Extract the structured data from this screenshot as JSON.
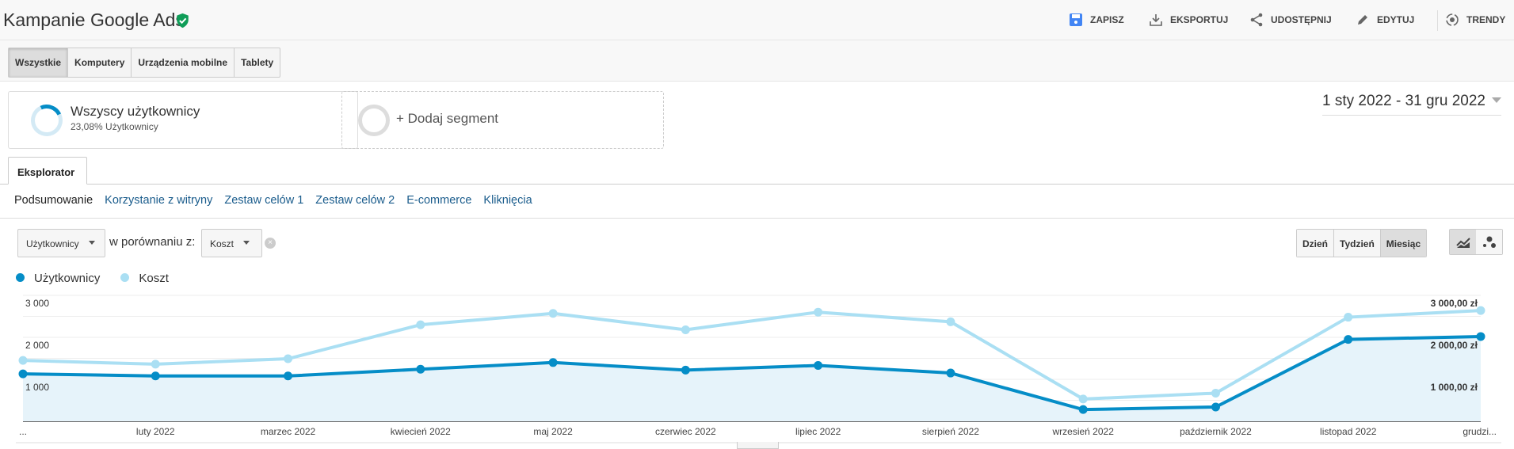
{
  "header": {
    "title": "Kampanie Google Ads",
    "actions": [
      {
        "label": "ZAPISZ",
        "icon": "save-icon"
      },
      {
        "label": "EKSPORTUJ",
        "icon": "download-icon"
      },
      {
        "label": "UDOSTĘPNIJ",
        "icon": "share-icon"
      },
      {
        "label": "EDYTUJ",
        "icon": "pencil-icon"
      },
      {
        "label": "TRENDY",
        "icon": "trends-icon"
      }
    ]
  },
  "device_tabs": [
    "Wszystkie",
    "Komputery",
    "Urządzenia mobilne",
    "Tablety"
  ],
  "segments": {
    "active": {
      "name": "Wszyscy użytkownicy",
      "detail": "23,08% Użytkownicy"
    },
    "add": "+ Dodaj segment"
  },
  "date_range": "1 sty 2022 - 31 gru 2022",
  "explorer_tab": "Eksplorator",
  "subtabs": [
    "Podsumowanie",
    "Korzystanie z witryny",
    "Zestaw celów 1",
    "Zestaw celów 2",
    "E-commerce",
    "Kliknięcia"
  ],
  "controls": {
    "metric1": "Użytkownicy",
    "compare_label": "w porównaniu z:",
    "metric2": "Koszt",
    "periods": [
      "Dzień",
      "Tydzień",
      "Miesiąc"
    ],
    "active_period": "Miesiąc"
  },
  "colors": {
    "users": "#058dc7",
    "cost": "#aadff3",
    "accent": "#1a5c8c",
    "verified": "#0f9d58"
  },
  "chart_data": {
    "type": "line",
    "categories": [
      "...",
      "luty 2022",
      "marzec 2022",
      "kwiecień 2022",
      "maj 2022",
      "czerwiec 2022",
      "lipiec 2022",
      "sierpień 2022",
      "wrzesień 2022",
      "październik 2022",
      "listopad 2022",
      "grudzi..."
    ],
    "series": [
      {
        "name": "Użytkownicy",
        "axis": "left",
        "values": [
          1130,
          1080,
          1080,
          1240,
          1400,
          1220,
          1330,
          1150,
          280,
          340,
          1950,
          2020
        ]
      },
      {
        "name": "Koszt",
        "axis": "right",
        "unit": "zł",
        "values": [
          1450,
          1360,
          1490,
          2300,
          2570,
          2180,
          2600,
          2370,
          530,
          670,
          2480,
          2640
        ]
      }
    ],
    "left_ticks": [
      "1 000",
      "2 000",
      "3 000"
    ],
    "right_ticks": [
      "1 000,00 zł",
      "2 000,00 zł",
      "3 000,00 zł"
    ],
    "ylim": [
      0,
      3000
    ],
    "grid": true,
    "legend": "top-left"
  }
}
